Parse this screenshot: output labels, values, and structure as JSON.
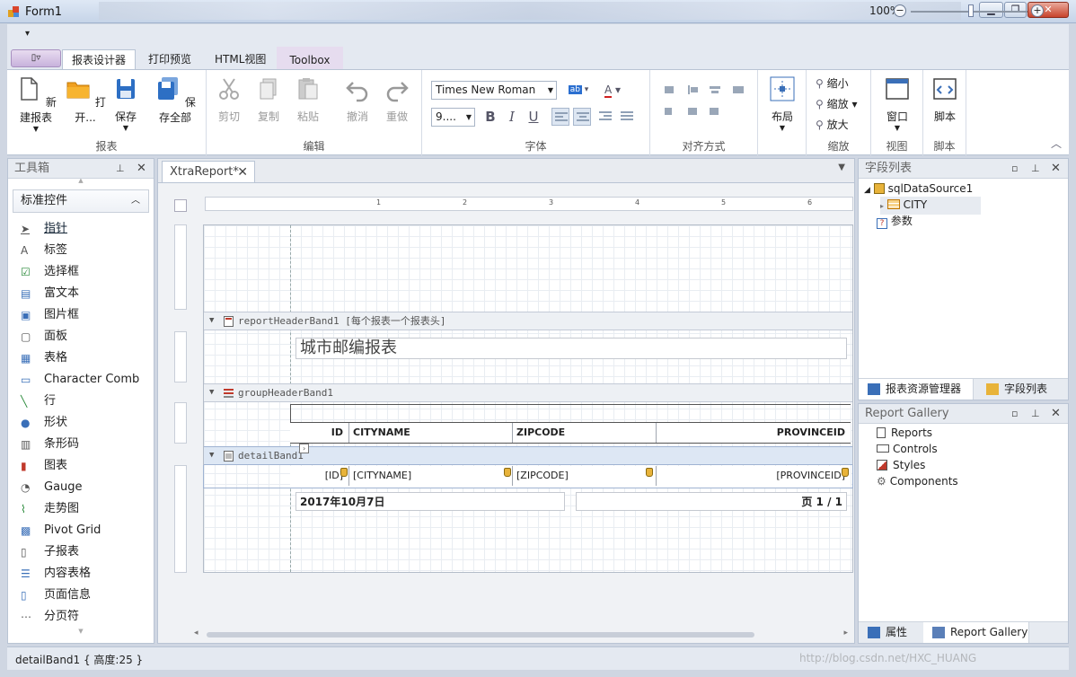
{
  "window": {
    "title": "Form1",
    "minimize": "▁",
    "restore": "❐",
    "close": "✕"
  },
  "ribbon": {
    "tabs": [
      {
        "label": "报表设计器"
      },
      {
        "label": "打印预览"
      },
      {
        "label": "HTML视图"
      },
      {
        "label": "Toolbox"
      }
    ],
    "groups": {
      "report": {
        "label": "报表",
        "buttons": [
          "新建报表",
          "打开...",
          "保存",
          "保存全部"
        ]
      },
      "edit": {
        "label": "编辑",
        "buttons": [
          "剪切",
          "复制",
          "粘贴",
          "撤消",
          "重做"
        ]
      },
      "font": {
        "label": "字体",
        "font_name": "Times New Roman",
        "font_size": "9....",
        "bold": "B",
        "italic": "I",
        "underline": "U"
      },
      "align": {
        "label": "对齐方式"
      },
      "layout": {
        "label": "布局"
      },
      "zoom": {
        "label": "缩放",
        "items": [
          "缩小",
          "缩放",
          "放大"
        ]
      },
      "view": {
        "label": "视图",
        "button": "窗口"
      },
      "script": {
        "label": "脚本",
        "button": "脚本"
      }
    }
  },
  "toolbox": {
    "title": "工具箱",
    "section": "标准控件",
    "items": [
      {
        "label": "指针",
        "icon": "pointer-icon"
      },
      {
        "label": "标签",
        "icon": "label-icon"
      },
      {
        "label": "选择框",
        "icon": "checkbox-icon"
      },
      {
        "label": "富文本",
        "icon": "richtext-icon"
      },
      {
        "label": "图片框",
        "icon": "picture-icon"
      },
      {
        "label": "面板",
        "icon": "panel-icon"
      },
      {
        "label": "表格",
        "icon": "table-icon"
      },
      {
        "label": "Character Comb",
        "icon": "charcomb-icon"
      },
      {
        "label": "行",
        "icon": "line-icon"
      },
      {
        "label": "形状",
        "icon": "shape-icon"
      },
      {
        "label": "条形码",
        "icon": "barcode-icon"
      },
      {
        "label": "图表",
        "icon": "chart-icon"
      },
      {
        "label": "Gauge",
        "icon": "gauge-icon"
      },
      {
        "label": "走势图",
        "icon": "sparkline-icon"
      },
      {
        "label": "Pivot Grid",
        "icon": "pivot-icon"
      },
      {
        "label": "子报表",
        "icon": "subreport-icon"
      },
      {
        "label": "内容表格",
        "icon": "toc-icon"
      },
      {
        "label": "页面信息",
        "icon": "pageinfo-icon"
      },
      {
        "label": "分页符",
        "icon": "pagebreak-icon"
      }
    ]
  },
  "document": {
    "tab": "XtraReport*",
    "ruler_marks": [
      "1",
      "2",
      "3",
      "4",
      "5",
      "6"
    ],
    "bands": {
      "report_header": "reportHeaderBand1 [每个报表一个报表头]",
      "group_header": "groupHeaderBand1",
      "detail": "detailBand1"
    },
    "report_title": "城市邮编报表",
    "columns": [
      "ID",
      "CITYNAME",
      "ZIPCODE",
      "PROVINCEID"
    ],
    "detail_fields": [
      "[ID]",
      "[CITYNAME]",
      "[ZIPCODE]",
      "[PROVINCEID]"
    ],
    "footer_date": "2017年10月7日",
    "footer_page": "页 1 / 1"
  },
  "field_list": {
    "title": "字段列表",
    "datasource": "sqlDataSource1",
    "table": "CITY",
    "params": "参数",
    "tabs": [
      "报表资源管理器",
      "字段列表"
    ]
  },
  "gallery": {
    "title": "Report Gallery",
    "items": [
      "Reports",
      "Controls",
      "Styles",
      "Components"
    ],
    "tabs": [
      "属性",
      "Report Gallery"
    ]
  },
  "status": {
    "text": "detailBand1 { 高度:25 }",
    "zoom": "100%",
    "watermark": "http://blog.csdn.net/HXC_HUANG"
  },
  "colors": {
    "accent": "#2b5797",
    "ribbon_bg": "#e4e9f1",
    "selected_band": "#dde7f4"
  }
}
